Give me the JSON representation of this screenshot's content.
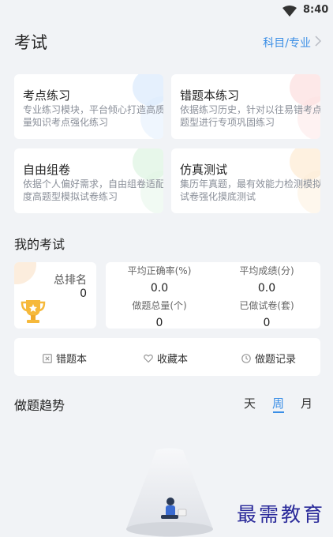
{
  "status": {
    "time": "8:40"
  },
  "header": {
    "title": "考试",
    "subject_link": "科目/专业"
  },
  "cards": [
    {
      "title": "考点练习",
      "desc": "专业练习模块，平台倾心打造高质量知识考点强化练习"
    },
    {
      "title": "错题本练习",
      "desc": "依据练习历史，针对以往易错考点题型进行专项巩固练习"
    },
    {
      "title": "自由组卷",
      "desc": "依据个人偏好需求，自由组卷适配度高题型模拟试卷练习"
    },
    {
      "title": "仿真测试",
      "desc": "集历年真题，最有效能力检测模拟试卷强化摸底测试"
    }
  ],
  "my_exam": {
    "title": "我的考试",
    "rank_label": "总排名",
    "rank_value": "0",
    "stats": [
      {
        "label": "平均正确率(%)",
        "value": "0.0"
      },
      {
        "label": "平均成绩(分)",
        "value": "0.0"
      },
      {
        "label": "做题总量(个)",
        "value": "0"
      },
      {
        "label": "已做试卷(套)",
        "value": "0"
      }
    ]
  },
  "tools": {
    "wrong_book": "错题本",
    "favorites": "收藏本",
    "history": "做题记录"
  },
  "trend": {
    "title": "做题趋势",
    "tabs": [
      "天",
      "周",
      "月"
    ],
    "active_tab": "周"
  },
  "watermark": "最需教育",
  "colors": {
    "accent": "#3a8ee6",
    "background": "#f1f3f6"
  }
}
